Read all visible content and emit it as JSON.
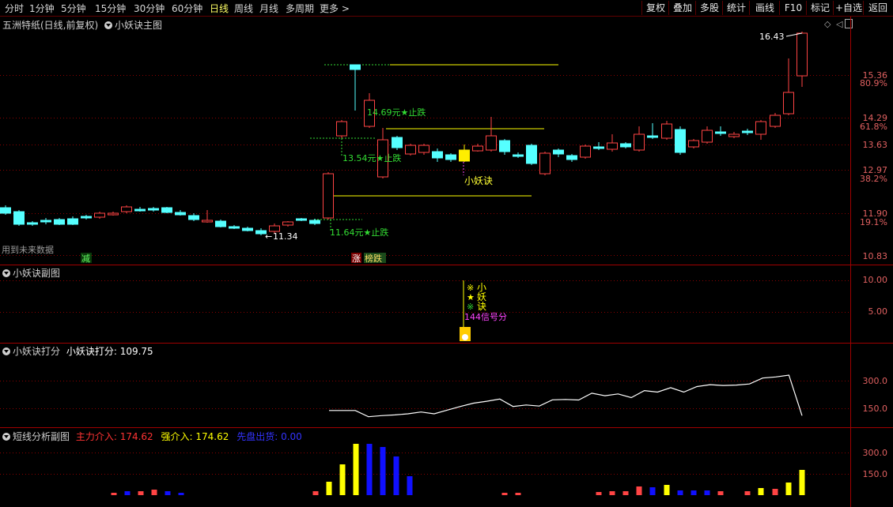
{
  "toolbar": {
    "tabs": [
      "分时",
      "1分钟",
      "5分钟",
      "15分钟",
      "30分钟",
      "60分钟",
      "日线",
      "周线",
      "月线",
      "多周期",
      "更多"
    ],
    "active_tab": "日线",
    "buttons": [
      "复权",
      "叠加",
      "多股",
      "统计",
      "画线",
      "F10",
      "标记",
      "+自选",
      "返回"
    ]
  },
  "main_chart": {
    "title": "五洲特纸(日线,前复权)",
    "indicator": "小妖诀主图",
    "price_labels": [
      "15.36",
      "14.29",
      "13.63",
      "12.97",
      "11.90",
      "10.83"
    ],
    "pct_labels": [
      "80.9%",
      "61.8%",
      "38.2%",
      "19.1%"
    ],
    "high_marker": "16.43",
    "low_marker": "11.34",
    "annotations": {
      "stop1": "14.69元★止跌",
      "stop2": "13.54元★止跌",
      "stop3": "11.64元★止跌",
      "signal": "小妖诀"
    },
    "notes": {
      "future": "用到未来数据",
      "jian": "减",
      "zhang": "涨",
      "bangdie": "榜跌"
    }
  },
  "sub1": {
    "title": "小妖诀副图",
    "y_labels": [
      "10.00",
      "5.00"
    ],
    "signal_lines": [
      "小",
      "妖",
      "诀"
    ],
    "signal_marks": [
      "※",
      "★",
      "※"
    ],
    "score_text": "144信号分"
  },
  "sub2": {
    "title": "小妖诀打分",
    "value_label": "小妖诀打分: 109.75",
    "y_labels": [
      "300.0",
      "150.0"
    ],
    "score_series": [
      138,
      138,
      138,
      104,
      110,
      114,
      120,
      130,
      120,
      140,
      160,
      178,
      188,
      200,
      160,
      168,
      162,
      196,
      198,
      195,
      232,
      218,
      228,
      208,
      246,
      238,
      262,
      238,
      268,
      278,
      274,
      276,
      282,
      314,
      320,
      330,
      110
    ]
  },
  "sub3": {
    "title": "短线分析副图",
    "legend_main": "主力介入: 174.62",
    "legend_strong": "强介入: 174.62",
    "legend_out": "先盘出货: 0.00",
    "y_labels": [
      "300.0",
      "150.0"
    ]
  },
  "colors": {
    "up": "#ff4444",
    "down": "#55ffff",
    "grid": "#8b0000",
    "yellow": "#ffff00",
    "blue": "#1010ff",
    "green": "#33dd33",
    "magenta": "#ff44ff"
  }
}
